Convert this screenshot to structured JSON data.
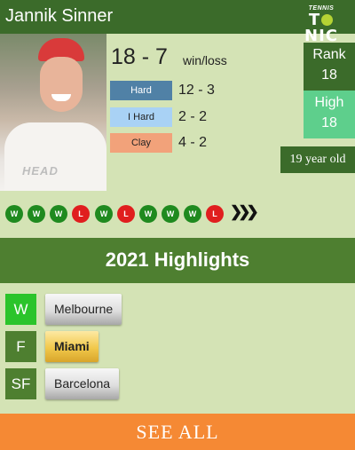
{
  "header": {
    "player_name": "Jannik Sinner",
    "logo_top": "TENNIS",
    "logo_bottom_left": "T",
    "logo_bottom_right": "NIC"
  },
  "photo": {
    "shirt_text": "HEAD"
  },
  "record": {
    "value": "18 - 7",
    "label": "win/loss"
  },
  "surfaces": [
    {
      "label": "Hard",
      "score": "12 - 3",
      "color": "#5081a6"
    },
    {
      "label": "I Hard",
      "score": "2 - 2",
      "color": "#a9d2f5"
    },
    {
      "label": "Clay",
      "score": "4 - 2",
      "color": "#f2a27a"
    }
  ],
  "rank": {
    "label": "Rank",
    "value": "18"
  },
  "high": {
    "label": "High",
    "value": "18"
  },
  "age": "19 year old",
  "recent_results": [
    "W",
    "W",
    "W",
    "L",
    "W",
    "L",
    "W",
    "W",
    "W",
    "L"
  ],
  "arrows_icon": "triple-chevron-right-icon",
  "highlights": {
    "title": "2021 Highlights",
    "tournaments": [
      {
        "result": "W",
        "name": "Melbourne",
        "result_color": "#2bc42b",
        "style": "silver"
      },
      {
        "result": "F",
        "name": "Miami",
        "result_color": "#4e7f30",
        "style": "gold"
      },
      {
        "result": "SF",
        "name": "Barcelona",
        "result_color": "#4e7f30",
        "style": "silver"
      }
    ]
  },
  "see_all": "SEE ALL",
  "colors": {
    "header": "#3b6b2a",
    "background": "#d4e3b5",
    "win": "#1f8a1f",
    "loss": "#e01e1e",
    "cta": "#f58934"
  }
}
